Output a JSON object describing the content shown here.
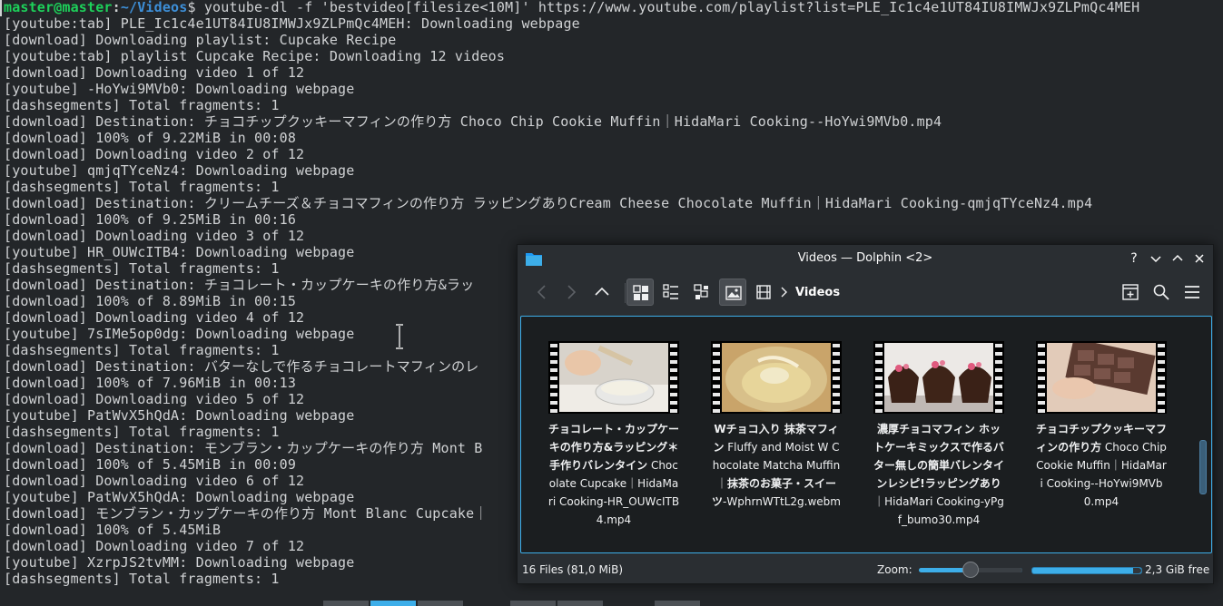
{
  "terminal": {
    "prompt": {
      "user_host": "master@master",
      "separator": ":",
      "path": "~/Videos",
      "dollar": "$",
      "command": " youtube-dl -f 'bestvideo[filesize<10M]' https://www.youtube.com/playlist?list=PLE_Ic1c4e1UT84IU8IMWJx9ZLPmQc4MEH"
    },
    "lines": [
      "[youtube:tab] PLE_Ic1c4e1UT84IU8IMWJx9ZLPmQc4MEH: Downloading webpage",
      "[download] Downloading playlist: Cupcake Recipe",
      "[youtube:tab] playlist Cupcake Recipe: Downloading 12 videos",
      "[download] Downloading video 1 of 12",
      "[youtube] -HoYwi9MVb0: Downloading webpage",
      "[dashsegments] Total fragments: 1",
      "[download] Destination: チョコチップクッキーマフィンの作り方 Choco Chip Cookie Muffin｜HidaMari Cooking--HoYwi9MVb0.mp4",
      "[download] 100% of 9.22MiB in 00:08",
      "[download] Downloading video 2 of 12",
      "[youtube] qmjqTYceNz4: Downloading webpage",
      "[dashsegments] Total fragments: 1",
      "[download] Destination: クリームチーズ＆チョコマフィンの作り方 ラッピングありCream Cheese Chocolate Muffin｜HidaMari Cooking-qmjqTYceNz4.mp4",
      "[download] 100% of 9.25MiB in 00:16",
      "[download] Downloading video 3 of 12",
      "[youtube] HR_OUWcITB4: Downloading webpage",
      "[dashsegments] Total fragments: 1",
      "[download] Destination: チョコレート・カップケーキの作り方&ラッ",
      "[download] 100% of 8.89MiB in 00:15",
      "[download] Downloading video 4 of 12",
      "[youtube] 7sIMe5op0dg: Downloading webpage",
      "[dashsegments] Total fragments: 1",
      "[download] Destination: バターなしで作るチョコレートマフィンのレ",
      "[download] 100% of 7.96MiB in 00:13",
      "[download] Downloading video 5 of 12",
      "[youtube] PatWvX5hQdA: Downloading webpage",
      "[dashsegments] Total fragments: 1",
      "[download] Destination: モンブラン・カップケーキの作り方 Mont B",
      "[download] 100% of 5.45MiB in 00:09",
      "[download] Downloading video 6 of 12",
      "[youtube] PatWvX5hQdA: Downloading webpage",
      "[download] モンブラン・カップケーキの作り方 Mont Blanc Cupcake｜",
      "[download] 100% of 5.45MiB",
      "[download] Downloading video 7 of 12",
      "[youtube] XzrpJS2tvMM: Downloading webpage",
      "[dashsegments] Total fragments: 1"
    ]
  },
  "dolphin": {
    "title": "Videos — Dolphin <2>",
    "window_buttons": {
      "help": "?",
      "minimize": "⌄",
      "maximize": "⌃",
      "close": "✕"
    },
    "breadcrumb": "Videos",
    "files": [
      {
        "name": "チョコレート・カップケーキの作り方&ラッピング＊手作りバレンタイン Chocolate Cupcake｜HidaMari Cooking-HR_OUWcITB4.mp4",
        "name_jp": "チョコレート・カップケーキの作り方&ラッピング＊手作りバレンタイン",
        "name_en": " Chocolate Cupcake｜HidaMari Cooking-HR_OUWcITB4.mp4"
      },
      {
        "name_jp": "Wチョコ入り 抹茶マフィン",
        "name_en": " Fluffy and Moist W Chocolate Matcha Muffin｜",
        "name_jp2": "抹茶のお菓子・スイーツ",
        "name_en2": "-WphrnWTtL2g.webm"
      },
      {
        "name_jp": "濃厚チョコマフィン ホットケーキミックスで作るバター無しの簡単バレンタインレシピ!ラッピングあり",
        "name_en": "｜HidaMari Cooking-yPgf_bumo30.mp4"
      },
      {
        "name_jp": "チョコチップクッキーマフィンの作り方",
        "name_en": " Choco Chip Cookie Muffin｜HidaMari Cooking--HoYwi9MVb0.mp4"
      }
    ],
    "status": {
      "count": "16 Files (81,0 MiB)",
      "zoom_label": "Zoom:",
      "zoom_level": 0.5,
      "free_space": "2,3 GiB free",
      "used_fraction": 0.93
    }
  },
  "colors": {
    "accent": "#3daee9",
    "prompt_user": "#1dd15a",
    "prompt_path": "#3d8fd8"
  }
}
